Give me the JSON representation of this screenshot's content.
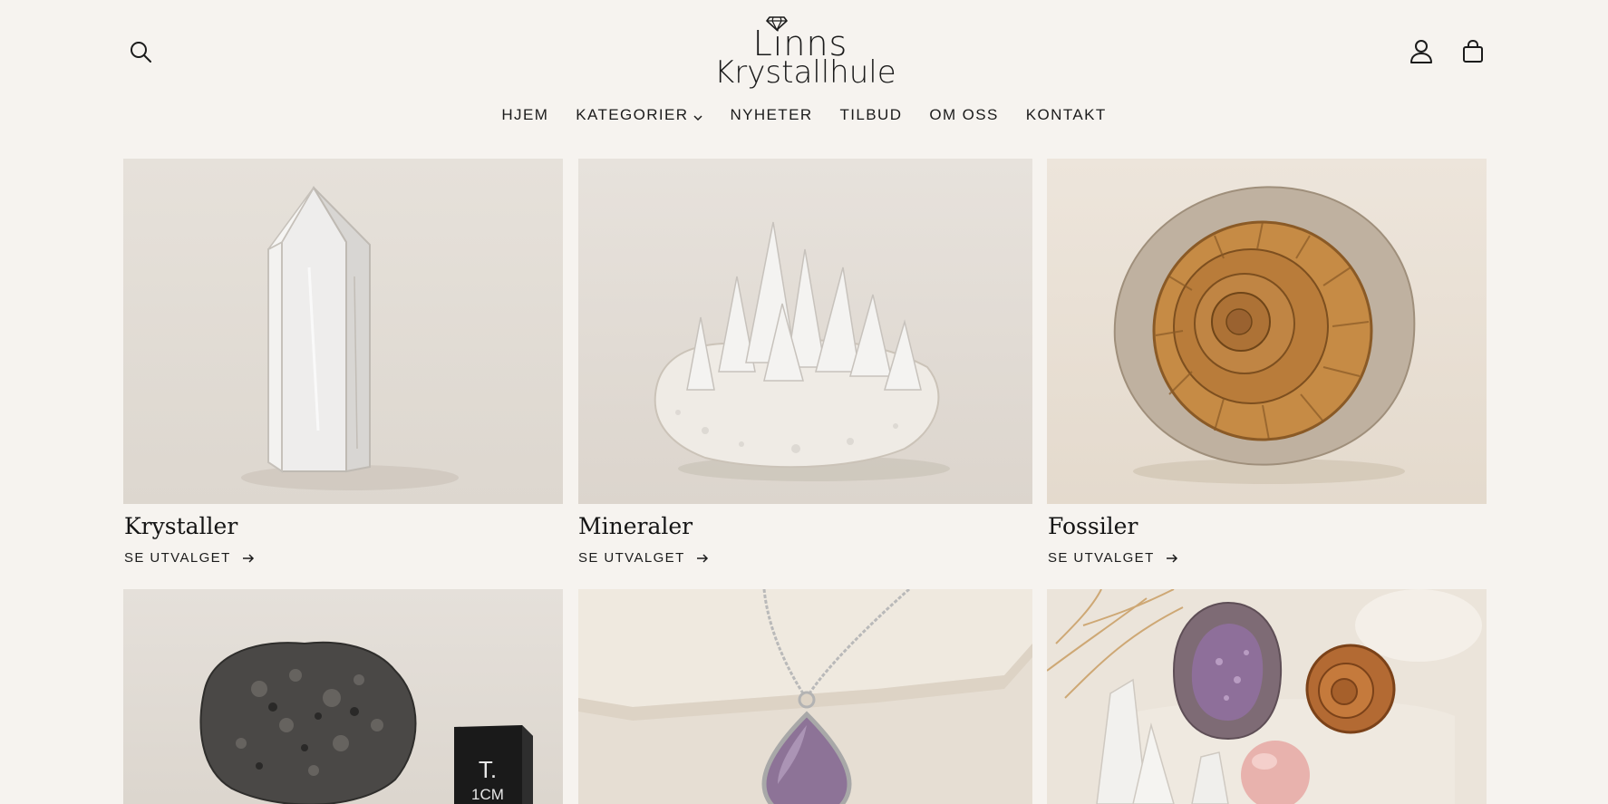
{
  "brand": {
    "line1": "Linns",
    "line2": "Krystallhule"
  },
  "nav": [
    {
      "label": "HJEM"
    },
    {
      "label": "KATEGORIER",
      "has_dropdown": true
    },
    {
      "label": "NYHETER"
    },
    {
      "label": "TILBUD"
    },
    {
      "label": "OM OSS"
    },
    {
      "label": "KONTAKT"
    }
  ],
  "icons": {
    "search": "search-icon",
    "account": "user-icon",
    "cart": "shopping-bag-icon",
    "logo": "diamond-icon",
    "arrow": "arrow-right-icon"
  },
  "categories": [
    {
      "title": "Krystaller",
      "link": "SE UTVALGET",
      "image": "clear quartz crystal point"
    },
    {
      "title": "Mineraler",
      "link": "SE UTVALGET",
      "image": "quartz crystal cluster"
    },
    {
      "title": "Fossiler",
      "link": "SE UTVALGET",
      "image": "ammonite fossil"
    }
  ],
  "second_row": [
    {
      "image": "meteorite with size cube",
      "cube_label_1": "T.",
      "cube_label_2": "1CM"
    },
    {
      "image": "amethyst pendant necklace"
    },
    {
      "image": "gemstone assortment with geode, ammonite and rose quartz sphere"
    }
  ],
  "colors": {
    "background": "#f6f3ef",
    "text": "#1b1b1b"
  }
}
